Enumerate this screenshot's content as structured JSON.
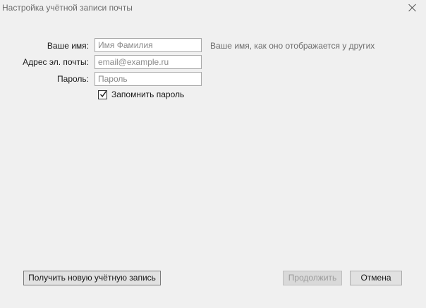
{
  "window": {
    "title": "Настройка учётной записи почты"
  },
  "form": {
    "name": {
      "label": "Ваше имя:",
      "value": "",
      "placeholder": "Имя Фамилия",
      "hint": "Ваше имя, как оно отображается у других"
    },
    "email": {
      "label": "Адрес эл. почты:",
      "value": "",
      "placeholder": "email@example.ru"
    },
    "password": {
      "label": "Пароль:",
      "value": "",
      "placeholder": "Пароль"
    },
    "remember_password": {
      "label": "Запомнить пароль",
      "checked": true
    }
  },
  "buttons": {
    "new_account": "Получить новую учётную запись",
    "continue": "Продолжить",
    "continue_disabled": true,
    "cancel": "Отмена"
  },
  "icons": {
    "close": "close-icon",
    "check": "checkmark-icon"
  }
}
